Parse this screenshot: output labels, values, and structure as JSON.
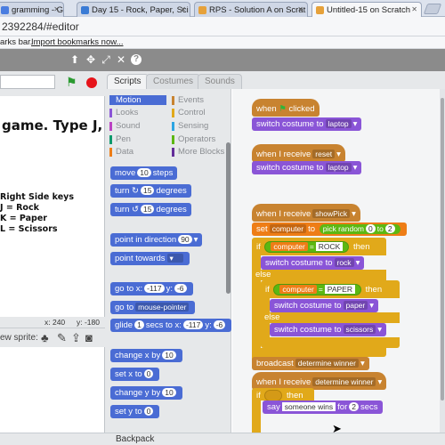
{
  "browser": {
    "tabs": [
      {
        "label": "gramming - Goo"
      },
      {
        "label": "Day 15 - Rock, Paper, Sci"
      },
      {
        "label": "RPS - Solution A on Scrat"
      },
      {
        "label": "Untitled-15 on Scratch"
      }
    ],
    "address": "2392284/#editor",
    "bookmarks_text": "arks bar.",
    "bookmarks_link": "Import bookmarks now..."
  },
  "stage": {
    "big_text": "game. Type J, K or",
    "keys_title": "Right Side keys",
    "keys": [
      "J = Rock",
      "K = Paper",
      "L = Scissors"
    ],
    "x_label": "x: 240",
    "y_label": "y: -180",
    "new_sprite": "ew sprite:"
  },
  "editor": {
    "tabs": [
      "Scripts",
      "Costumes",
      "Sounds"
    ],
    "categories_left": [
      "Motion",
      "Looks",
      "Sound",
      "Pen",
      "Data"
    ],
    "categories_right": [
      "Events",
      "Control",
      "Sensing",
      "Operators",
      "More Blocks"
    ],
    "backpack": "Backpack"
  },
  "palette_blocks": {
    "move_a": "move",
    "move_n": "10",
    "move_b": "steps",
    "turn_r_a": "turn",
    "turn_r_n": "15",
    "turn_r_b": "degrees",
    "turn_l_a": "turn",
    "turn_l_n": "15",
    "turn_l_b": "degrees",
    "point_dir_a": "point in direction",
    "point_dir_n": "90",
    "point_towards_a": "point towards",
    "goto_xy_a": "go to x:",
    "goto_xy_x": "-117",
    "goto_xy_b": "y:",
    "goto_xy_y": "-6",
    "goto_a": "go to",
    "goto_dd": "mouse-pointer",
    "glide_a": "glide",
    "glide_n": "1",
    "glide_b": "secs to x:",
    "glide_x": "-117",
    "glide_c": "y:",
    "glide_y": "-6",
    "changex_a": "change x by",
    "changex_n": "10",
    "setx_a": "set x to",
    "setx_n": "0",
    "changey_a": "change y by",
    "changey_n": "10",
    "sety_a": "set y to",
    "sety_n": "0"
  },
  "scripts": {
    "s1_hat_a": "when",
    "s1_hat_b": "clicked",
    "s1_switch_a": "switch costume to",
    "s1_switch_dd": "laptop",
    "s2_hat_a": "when I receive",
    "s2_hat_dd": "reset",
    "s2_switch_a": "switch costume to",
    "s2_switch_dd": "laptop",
    "s3_hat_a": "when I receive",
    "s3_hat_dd": "showPick",
    "s3_set_a": "set",
    "s3_set_dd": "computer",
    "s3_set_b": "to",
    "s3_set_c": "pick random",
    "s3_set_n1": "0",
    "s3_set_d": "to",
    "s3_set_n2": "2",
    "if1_a": "if",
    "if1_var": "computer",
    "if1_eq": "=",
    "if1_val": "ROCK",
    "if1_b": "then",
    "sw_rock_a": "switch costume to",
    "sw_rock_dd": "rock",
    "else1": "else",
    "if2_a": "if",
    "if2_var": "computer",
    "if2_eq": "=",
    "if2_val": "PAPER",
    "if2_b": "then",
    "sw_paper_a": "switch costume to",
    "sw_paper_dd": "paper",
    "else2": "else",
    "sw_sc_a": "switch costume to",
    "sw_sc_dd": "scissors",
    "broadcast_a": "broadcast",
    "broadcast_dd": "determine winner",
    "s4_hat_a": "when I receive",
    "s4_hat_dd": "determine winner",
    "if3_a": "if",
    "if3_b": "then",
    "say_a": "say",
    "say_str": "someone wins",
    "say_b": "for",
    "say_n": "2",
    "say_c": "secs"
  },
  "colors": {
    "motion": "#4a6cd4",
    "looks": "#8a55d7",
    "events": "#c88330",
    "control": "#e1a91a",
    "operators": "#5cb712",
    "data": "#ee7d16"
  }
}
